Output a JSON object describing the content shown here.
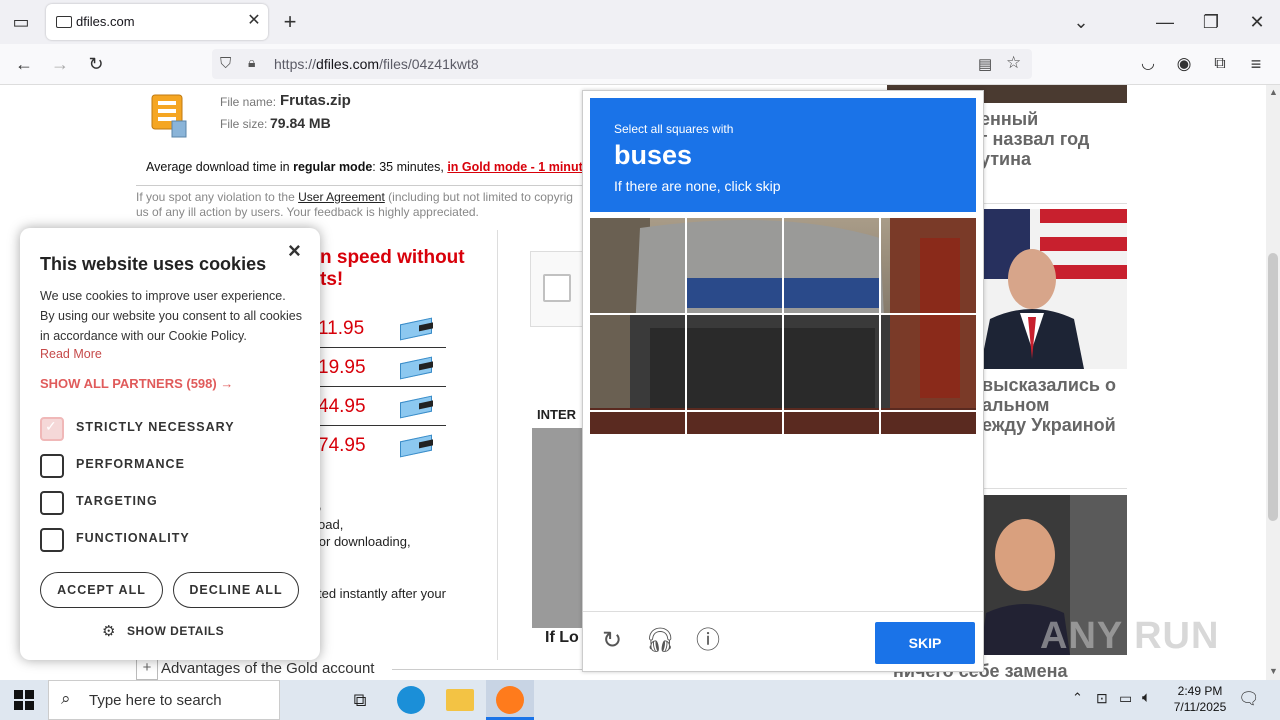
{
  "browser": {
    "tab_title": "dfiles.com",
    "url_prefix": "https://",
    "url_domain": "dfiles.com",
    "url_path": "/files/04z41kwt8"
  },
  "file": {
    "name_label": "File name:",
    "name": "Frutas.zip",
    "size_label": "File size:",
    "size": "79.84 MB"
  },
  "download": {
    "avg_prefix": "Average download time in ",
    "regular": "regular mode",
    "regular_time": ": 35 minutes, ",
    "gold": "in Gold mode - 1 minut"
  },
  "violation": {
    "line1_a": "If you spot any violation to the ",
    "agreement": "User Agreement",
    "line1_b": " (including but not limited to copyrig",
    "line2": "us of any ill action by users. Your feedback is highly appreciated."
  },
  "gold_box": {
    "heading_1": "n speed without",
    "heading_2": "ts!",
    "prices": [
      "11.95",
      "19.95",
      "44.95",
      "74.95"
    ],
    "frag_1": ",",
    "frag_2": "oad,",
    "frag_3": "er for downloading,",
    "frag_4": "ted instantly after your"
  },
  "inter_label": "INTER",
  "if_lo": "If Lo",
  "advantages": "Advantages of the Gold account",
  "news": [
    {
      "lines": [
        "енный",
        "г назвал год",
        "утина"
      ]
    },
    {
      "lines": [
        "высказались о",
        "альном",
        "ежду Украиной"
      ]
    },
    {
      "lines": [
        "ничего себе замена"
      ]
    }
  ],
  "cookie": {
    "title": "This website uses cookies",
    "close": "×",
    "body": "We use cookies to improve user experience. By using our website you consent to all cookies in accordance with our Cookie Policy.",
    "read_more": "Read More",
    "partners": "SHOW ALL PARTNERS (598) →",
    "options": [
      {
        "label": "STRICTLY NECESSARY",
        "checked": true
      },
      {
        "label": "PERFORMANCE",
        "checked": false
      },
      {
        "label": "TARGETING",
        "checked": false
      },
      {
        "label": "FUNCTIONALITY",
        "checked": false
      }
    ],
    "accept": "ACCEPT ALL",
    "decline": "DECLINE ALL",
    "details": "SHOW DETAILS"
  },
  "captcha": {
    "line1": "Select all squares with",
    "target": "buses",
    "line3": "If there are none, click skip",
    "skip": "SKIP"
  },
  "taskbar": {
    "search_placeholder": "Type here to search",
    "time": "2:49 PM",
    "date": "7/11/2025"
  },
  "watermark": "ANY RUN",
  "colors": {
    "captcha_blue": "#1a73e8",
    "gold_red": "#d8000a",
    "cookie_accent": "#e05b5b"
  }
}
